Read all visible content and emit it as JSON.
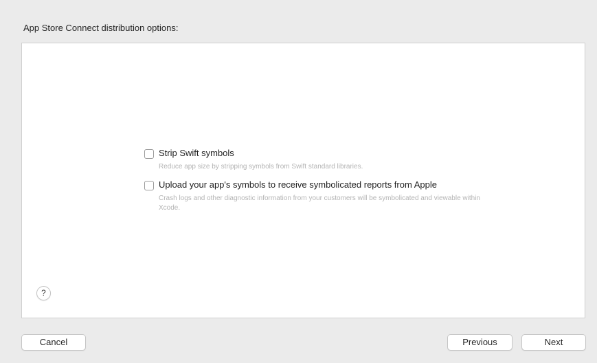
{
  "title": "App Store Connect distribution options:",
  "options": [
    {
      "label": "Strip Swift symbols",
      "description": "Reduce app size by stripping symbols from Swift standard libraries.",
      "checked": false
    },
    {
      "label": "Upload your app's symbols to receive symbolicated reports from Apple",
      "description": "Crash logs and other diagnostic information from your customers will be symbolicated and viewable within Xcode.",
      "checked": false
    }
  ],
  "help": {
    "label": "?"
  },
  "buttons": {
    "cancel": "Cancel",
    "previous": "Previous",
    "next": "Next"
  },
  "colors": {
    "window_background": "#ebebeb",
    "panel_background": "#ffffff",
    "description_text": "#b4b4b4"
  }
}
